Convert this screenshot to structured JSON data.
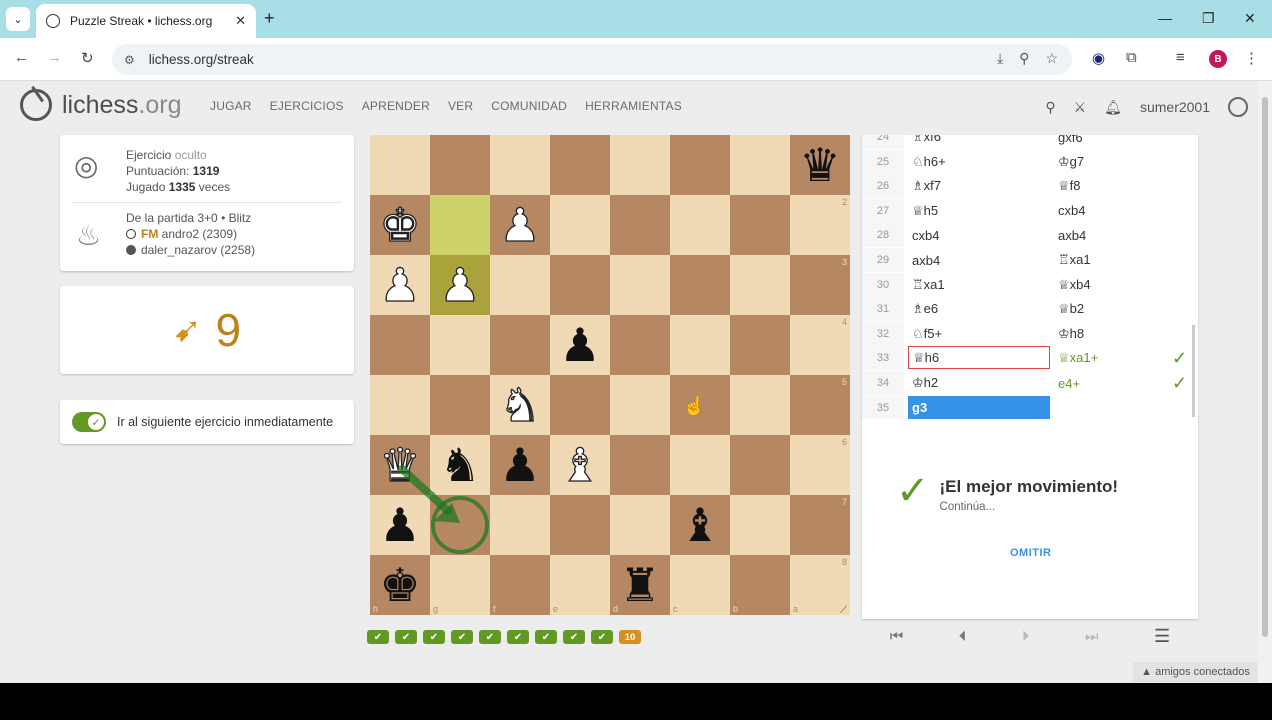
{
  "browser": {
    "tab_title": "Puzzle Streak • lichess.org",
    "url": "lichess.org/streak",
    "profile_initial": "B"
  },
  "site": {
    "logo_main": "lichess",
    "logo_suffix": ".org",
    "nav": [
      "JUGAR",
      "EJERCICIOS",
      "APRENDER",
      "VER",
      "COMUNIDAD",
      "HERRAMIENTAS"
    ],
    "username": "sumer2001"
  },
  "puzzle": {
    "label": "Ejercicio",
    "label_hidden": "oculto",
    "rating_label": "Puntuación:",
    "rating": "1319",
    "played_prefix": "Jugado",
    "played": "1335",
    "played_suffix": "veces",
    "game_line": "De la partida 3+0 • Blitz",
    "white_title": "FM",
    "white_player": "andro2 (2309)",
    "black_player": "daler_nazarov (2258)"
  },
  "streak": {
    "count": "9"
  },
  "toggle": {
    "label": "Ir al siguiente ejercicio inmediatamente",
    "on": true
  },
  "board": {
    "ranks": [
      "1",
      "2",
      "3",
      "4",
      "5",
      "6",
      "7",
      "8"
    ],
    "files": [
      "h",
      "g",
      "f",
      "e",
      "d",
      "c",
      "b",
      "a"
    ],
    "pieces": [
      {
        "sq": "a1",
        "glyph": "♛",
        "color": "b"
      },
      {
        "sq": "h2",
        "glyph": "♚",
        "color": "w"
      },
      {
        "sq": "f2",
        "glyph": "♟",
        "color": "w"
      },
      {
        "sq": "h3",
        "glyph": "♟",
        "color": "w"
      },
      {
        "sq": "g3",
        "glyph": "♟",
        "color": "w"
      },
      {
        "sq": "e4",
        "glyph": "♟",
        "color": "b"
      },
      {
        "sq": "f5",
        "glyph": "♞",
        "color": "w"
      },
      {
        "sq": "h6",
        "glyph": "♛",
        "color": "w"
      },
      {
        "sq": "g6",
        "glyph": "♞",
        "color": "b"
      },
      {
        "sq": "f6",
        "glyph": "♟",
        "color": "b"
      },
      {
        "sq": "e6",
        "glyph": "♝",
        "color": "w"
      },
      {
        "sq": "h7",
        "glyph": "♟",
        "color": "b"
      },
      {
        "sq": "c7",
        "glyph": "♝",
        "color": "b"
      },
      {
        "sq": "h8",
        "glyph": "♚",
        "color": "b"
      },
      {
        "sq": "d8",
        "glyph": "♜",
        "color": "b"
      }
    ],
    "last_move": [
      "g2",
      "g3"
    ]
  },
  "progress": {
    "solved": 9,
    "current": "10"
  },
  "moves": [
    {
      "n": "24",
      "w": "♗xf6",
      "b": "gxf6"
    },
    {
      "n": "25",
      "w": "♘h6+",
      "b": "♔g7"
    },
    {
      "n": "26",
      "w": "♗xf7",
      "b": "♕f8"
    },
    {
      "n": "27",
      "w": "♕h5",
      "b": "cxb4"
    },
    {
      "n": "28",
      "w": "cxb4",
      "b": "axb4"
    },
    {
      "n": "29",
      "w": "axb4",
      "b": "♖xa1"
    },
    {
      "n": "30",
      "w": "♖xa1",
      "b": "♕xb4"
    },
    {
      "n": "31",
      "w": "♗e6",
      "b": "♕b2"
    },
    {
      "n": "32",
      "w": "♘f5+",
      "b": "♔h8"
    },
    {
      "n": "33",
      "w": "♕h6",
      "b": "♕xa1+",
      "state": "boxed",
      "good": true
    },
    {
      "n": "34",
      "w": "♔h2",
      "b": "e4+",
      "good": true
    },
    {
      "n": "35",
      "w": "g3",
      "b": "",
      "state": "active"
    }
  ],
  "feedback": {
    "title": "¡El mejor movimiento!",
    "subtitle": "Continúa...",
    "skip": "OMITIR"
  },
  "footer": {
    "friends": "amigos conectados"
  }
}
